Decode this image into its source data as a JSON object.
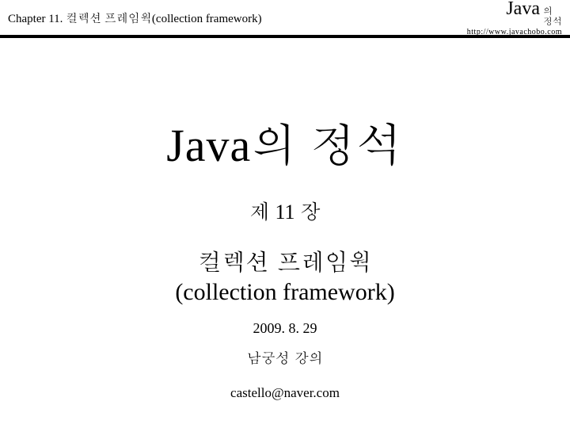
{
  "header": {
    "left": "Chapter 11. 컬렉션 프레임웍(collection framework)",
    "brand_java": "Java",
    "brand_small_1": "의",
    "brand_small_2": "정석",
    "url": "http://www.javachobo.com"
  },
  "content": {
    "main_title": "Java의 정석",
    "chapter_num": "제 11 장",
    "chapter_title_ko": "컬렉션 프레임웍",
    "chapter_title_en": "(collection framework)",
    "date": "2009. 8. 29",
    "lecturer": "남궁성 강의",
    "email": "castello@naver.com"
  }
}
